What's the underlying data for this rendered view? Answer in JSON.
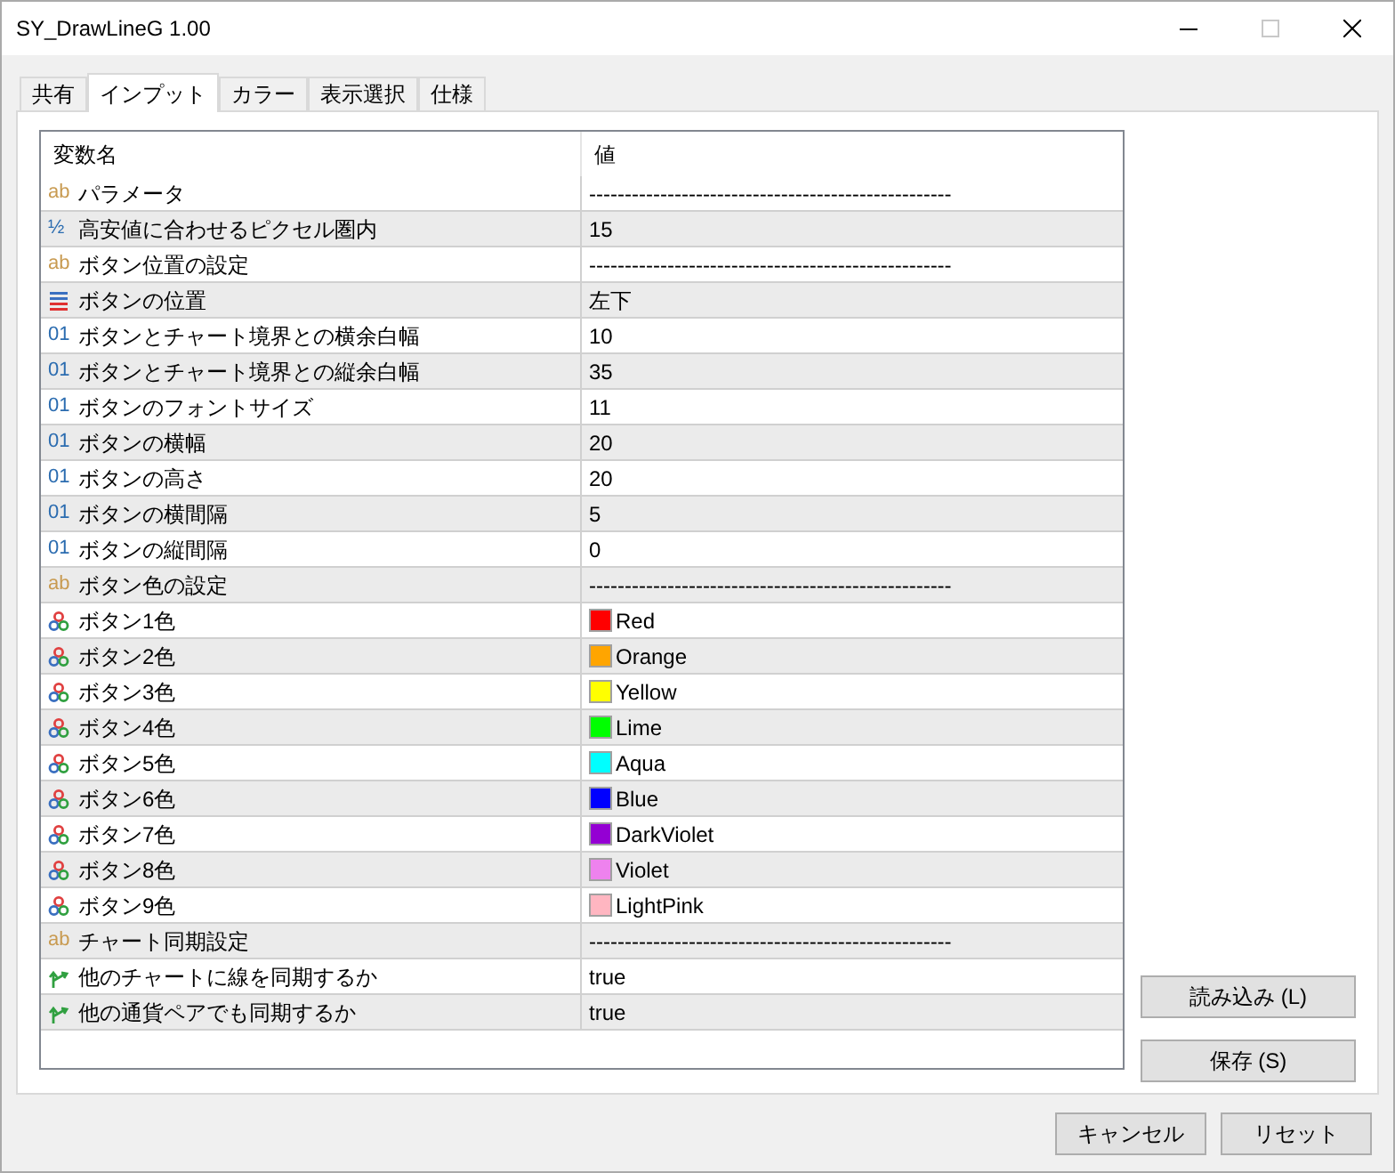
{
  "window": {
    "title": "SY_DrawLineG 1.00"
  },
  "tabs": [
    {
      "label": "共有",
      "selected": false
    },
    {
      "label": "インプット",
      "selected": true
    },
    {
      "label": "カラー",
      "selected": false
    },
    {
      "label": "表示選択",
      "selected": false
    },
    {
      "label": "仕様",
      "selected": false
    }
  ],
  "table": {
    "columns": [
      "変数名",
      "値"
    ],
    "rows": [
      {
        "kind": "string",
        "icon": "ab",
        "name": "パラメータ",
        "value": "---------------------------------------------------"
      },
      {
        "kind": "fraction",
        "icon": "½",
        "name": "高安値に合わせるピクセル圏内",
        "value": "15"
      },
      {
        "kind": "string",
        "icon": "ab",
        "name": "ボタン位置の設定",
        "value": "---------------------------------------------------"
      },
      {
        "kind": "enum",
        "name": "ボタンの位置",
        "value": "左下"
      },
      {
        "kind": "int",
        "icon": "01",
        "name": "ボタンとチャート境界との横余白幅",
        "value": "10"
      },
      {
        "kind": "int",
        "icon": "01",
        "name": "ボタンとチャート境界との縦余白幅",
        "value": "35"
      },
      {
        "kind": "int",
        "icon": "01",
        "name": "ボタンのフォントサイズ",
        "value": "11"
      },
      {
        "kind": "int",
        "icon": "01",
        "name": "ボタンの横幅",
        "value": "20"
      },
      {
        "kind": "int",
        "icon": "01",
        "name": "ボタンの高さ",
        "value": "20"
      },
      {
        "kind": "int",
        "icon": "01",
        "name": "ボタンの横間隔",
        "value": "5"
      },
      {
        "kind": "int",
        "icon": "01",
        "name": "ボタンの縦間隔",
        "value": "0"
      },
      {
        "kind": "string",
        "icon": "ab",
        "name": "ボタン色の設定",
        "value": "---------------------------------------------------"
      },
      {
        "kind": "color",
        "name": "ボタン1色",
        "value": "Red",
        "color": "#ff0000"
      },
      {
        "kind": "color",
        "name": "ボタン2色",
        "value": "Orange",
        "color": "#ffa500"
      },
      {
        "kind": "color",
        "name": "ボタン3色",
        "value": "Yellow",
        "color": "#ffff00"
      },
      {
        "kind": "color",
        "name": "ボタン4色",
        "value": "Lime",
        "color": "#00ff00"
      },
      {
        "kind": "color",
        "name": "ボタン5色",
        "value": "Aqua",
        "color": "#00ffff"
      },
      {
        "kind": "color",
        "name": "ボタン6色",
        "value": "Blue",
        "color": "#0000ff"
      },
      {
        "kind": "color",
        "name": "ボタン7色",
        "value": "DarkViolet",
        "color": "#9400d3"
      },
      {
        "kind": "color",
        "name": "ボタン8色",
        "value": "Violet",
        "color": "#ee82ee"
      },
      {
        "kind": "color",
        "name": "ボタン9色",
        "value": "LightPink",
        "color": "#ffb6c1"
      },
      {
        "kind": "string",
        "icon": "ab",
        "name": "チャート同期設定",
        "value": "---------------------------------------------------"
      },
      {
        "kind": "bool",
        "name": "他のチャートに線を同期するか",
        "value": "true"
      },
      {
        "kind": "bool",
        "name": "他の通貨ペアでも同期するか",
        "value": "true"
      }
    ]
  },
  "side_buttons": [
    "読み込み (L)",
    "保存 (S)"
  ],
  "footer_buttons": [
    "キャンセル",
    "リセット"
  ]
}
